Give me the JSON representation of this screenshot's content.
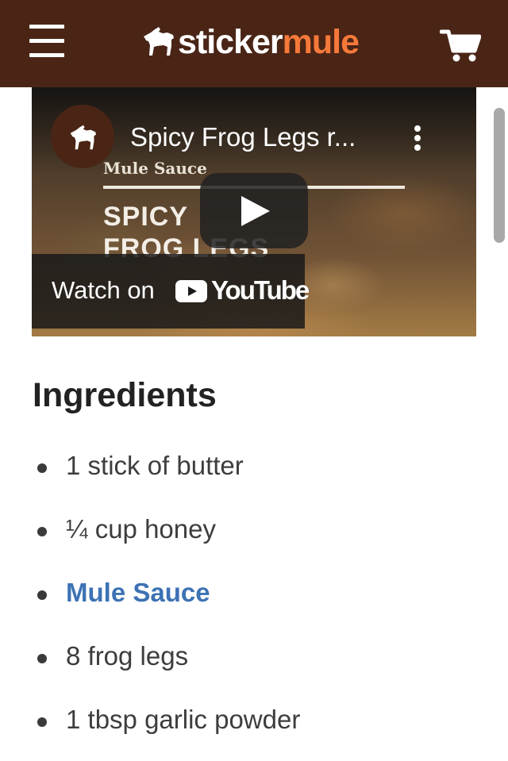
{
  "header": {
    "logo_part1": "sticker",
    "logo_part2": "mule",
    "menu_icon": "hamburger-menu-icon",
    "cart_icon": "shopping-cart-icon",
    "bg_color": "#4a2516",
    "accent_color": "#f7793a"
  },
  "video": {
    "title": "Spicy Frog Legs r...",
    "channel_icon": "mule-logo-icon",
    "thumbnail_brand": "Mule Sauce",
    "thumbnail_line1": "SPICY",
    "thumbnail_line2": "FROG LEGS",
    "watch_on_label": "Watch on",
    "youtube_label": "YouTube"
  },
  "ingredients": {
    "title": "Ingredients",
    "items": [
      {
        "text": "1 stick of butter",
        "link": false
      },
      {
        "text": "¼ cup honey",
        "link": false
      },
      {
        "text": "Mule Sauce",
        "link": true
      },
      {
        "text": "8 frog legs",
        "link": false
      },
      {
        "text": "1 tbsp garlic powder",
        "link": false
      }
    ],
    "link_color": "#3d72b4"
  }
}
